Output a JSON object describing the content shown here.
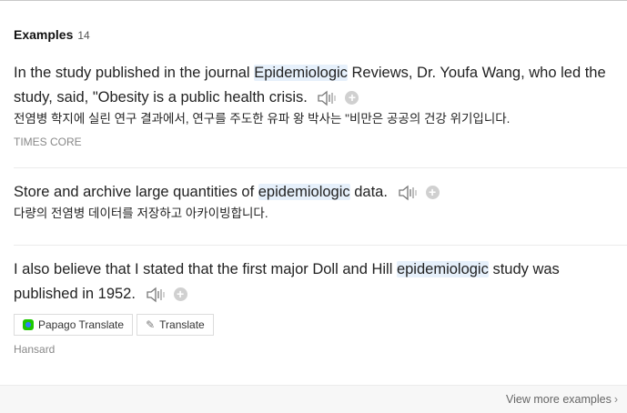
{
  "header": {
    "title": "Examples",
    "count": "14"
  },
  "examples": [
    {
      "sentence_before": "In the study published in the journal ",
      "highlight": "Epidemiologic",
      "sentence_after_line1": " Reviews, Dr. Youfa Wang, who led the",
      "sentence_line2": "study, said, \"Obesity is a public health crisis.",
      "translation": "전염병 학지에 실린 연구 결과에서, 연구를 주도한 유파 왕 박사는 \"비만은 공공의 건강 위기입니다.",
      "source": "TIMES CORE"
    },
    {
      "sentence_before": "Store and archive large quantities of ",
      "highlight": "epidemiologic",
      "sentence_after": " data.",
      "translation": "다량의 전염병 데이터를 저장하고 아카이빙합니다."
    },
    {
      "sentence_before": "I also believe that I stated that the first major Doll and Hill ",
      "highlight": "epidemiologic",
      "sentence_after_line1": " study was",
      "sentence_line2": "published in 1952.",
      "papago_label": "Papago Translate",
      "translate_label": "Translate",
      "source": "Hansard"
    }
  ],
  "icons": {
    "speaker": "speaker-icon",
    "add": "plus-circle-icon",
    "papago": "papago-logo-icon",
    "translate": "pen-icon",
    "chevron": "chevron-right-icon"
  },
  "plus_glyph": "+",
  "footer": {
    "view_more": "View more examples"
  },
  "colors": {
    "highlight_bg": "#e6f0fb",
    "muted": "#888888",
    "footer_bg": "#f7f7f7"
  }
}
